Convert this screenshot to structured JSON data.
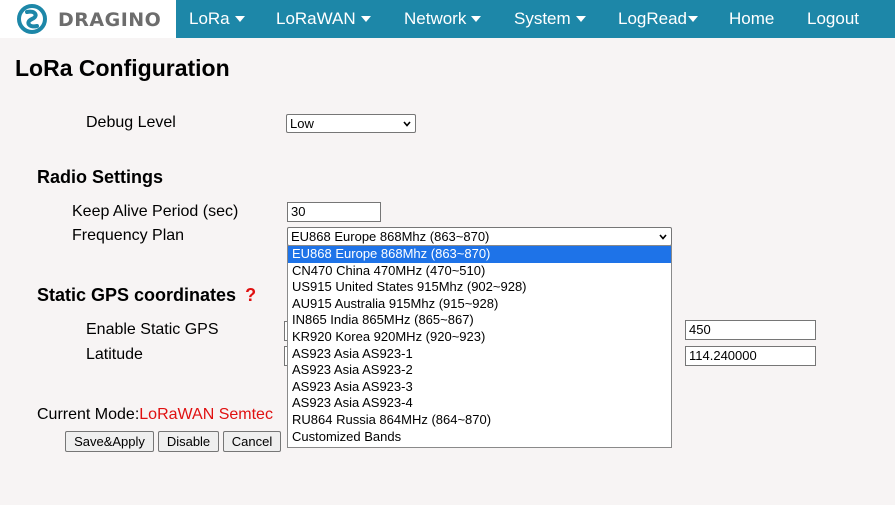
{
  "nav": {
    "logo_text": "DRAGINO",
    "items": [
      {
        "label": "LoRa",
        "has_caret": true
      },
      {
        "label": "LoRaWAN",
        "has_caret": true
      },
      {
        "label": "Network",
        "has_caret": true
      },
      {
        "label": "System",
        "has_caret": true
      },
      {
        "label": "LogRead",
        "has_caret": true
      },
      {
        "label": "Home",
        "has_caret": false
      },
      {
        "label": "Logout",
        "has_caret": false
      }
    ]
  },
  "page": {
    "title": "LoRa Configuration"
  },
  "debug": {
    "label": "Debug Level",
    "value": "Low"
  },
  "radio": {
    "title": "Radio Settings",
    "keep_alive_label": "Keep Alive Period (sec)",
    "keep_alive_value": "30",
    "freq_plan_label": "Frequency Plan",
    "freq_plan_value": "EU868 Europe 868Mhz (863~870)"
  },
  "freq_options": [
    "EU868 Europe 868Mhz (863~870)",
    "CN470 China 470MHz (470~510)",
    "US915 United States 915Mhz (902~928)",
    "AU915 Australia 915Mhz (915~928)",
    "IN865 India 865MHz (865~867)",
    "KR920 Korea 920MHz (920~923)",
    "AS923 Asia AS923-1",
    "AS923 Asia AS923-2",
    "AS923 Asia AS923-3",
    "AS923 Asia AS923-4",
    "RU864 Russia 864MHz (864~870)",
    "Customized Bands"
  ],
  "gps": {
    "title": "Static GPS coordinates",
    "help": "?",
    "enable_label": "Enable Static GPS",
    "latitude_label": "Latitude",
    "altitude_value": "450",
    "longitude_value": "114.240000"
  },
  "mode": {
    "label": "Current Mode:",
    "value": "LoRaWAN Semtec"
  },
  "buttons": {
    "save": "Save&Apply",
    "disable": "Disable",
    "cancel": "Cancel"
  },
  "colors": {
    "nav_bg": "#1d87a8",
    "highlight": "#1e73e8",
    "alert": "#e01010"
  }
}
